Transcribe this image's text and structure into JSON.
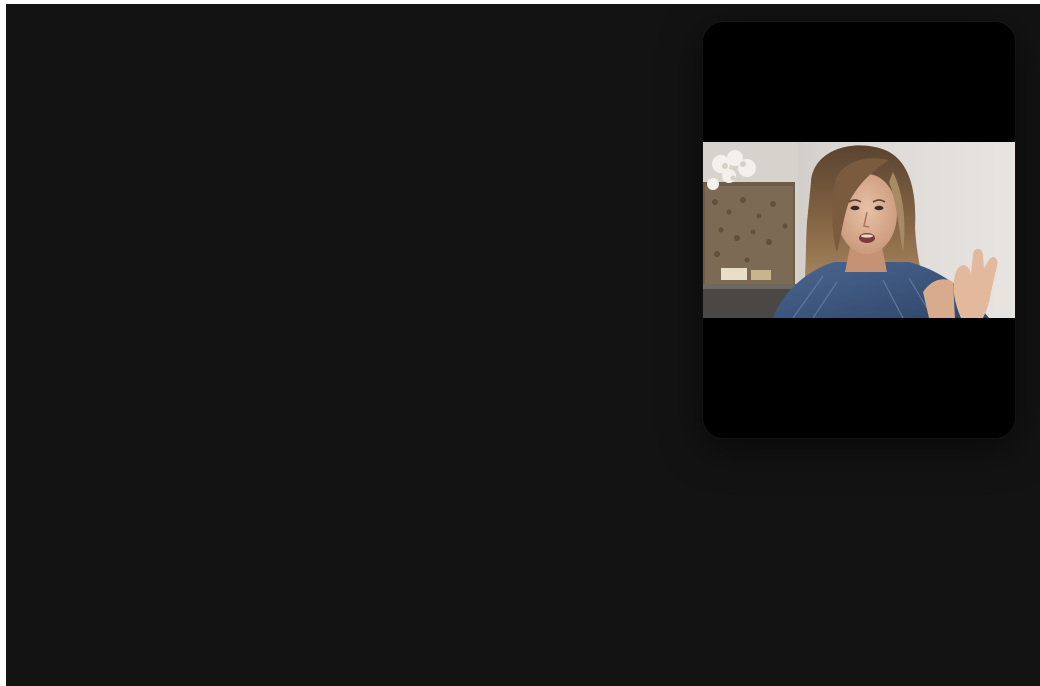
{
  "screen": {
    "background": "#131313"
  },
  "pip": {
    "window_color": "#000000",
    "video": {
      "content": "person-speaking",
      "letterbox": "top-and-bottom"
    }
  }
}
